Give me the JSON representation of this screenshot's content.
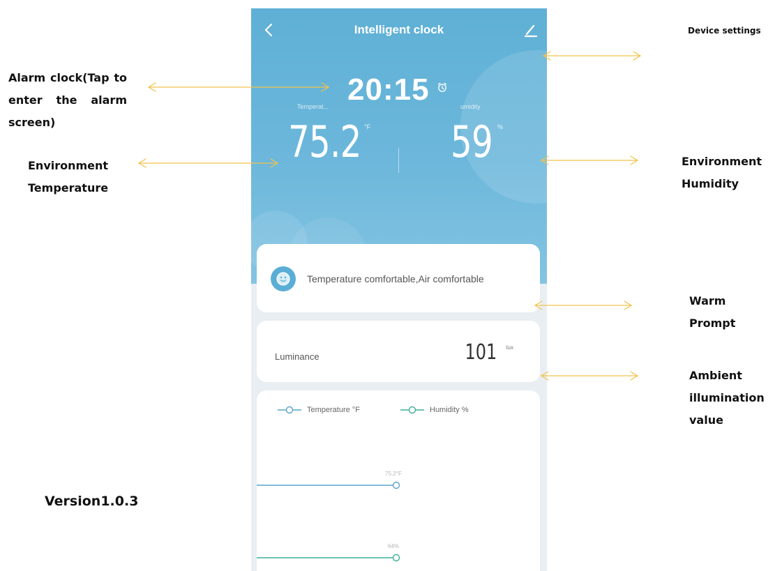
{
  "header": {
    "title": "Intelligent clock"
  },
  "clock": {
    "time": "20:15"
  },
  "temperature": {
    "label": "Temperat...",
    "value": "75.2",
    "unit": "°F"
  },
  "humidity": {
    "label": "umidity",
    "value": "59",
    "unit": "%"
  },
  "prompt": {
    "text": "Temperature comfortable,Air comfortable"
  },
  "luminance": {
    "label": "Luminance",
    "value": "101",
    "unit": "lux"
  },
  "chart_data": {
    "type": "line",
    "series": [
      {
        "name": "Temperature °F",
        "values": [
          75.2
        ],
        "point_label": "75.2°F"
      },
      {
        "name": "Humidity %",
        "values": [
          64
        ],
        "point_label": "64%"
      }
    ]
  },
  "annotations": {
    "device_settings": "Device settings",
    "alarm_clock": "Alarm clock(Tap to enter the alarm screen)",
    "environment_temperature": "Environment Temperature",
    "environment_humidity": "Environment Humidity",
    "warm_prompt": "Warm Prompt",
    "ambient_illumination": "Ambient illumination value",
    "version": "Version1.0.3"
  },
  "colors": {
    "hero_blue": "#5fb0d6",
    "temperature_line": "#5aa3cf",
    "humidity_line": "#3fae9a",
    "arrow": "#f2c24a"
  },
  "icons": {
    "back": "chevron-left-icon",
    "edit": "pencil-icon",
    "alarm": "alarm-clock-icon",
    "comfort": "smiley-face-icon"
  }
}
